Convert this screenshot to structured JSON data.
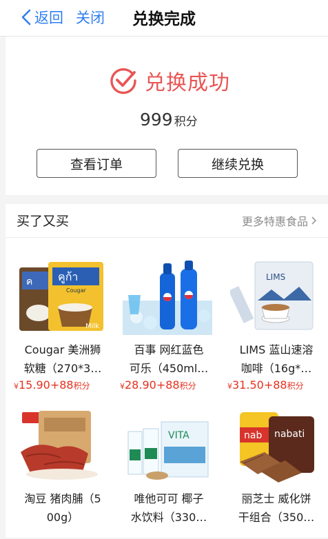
{
  "header": {
    "back_label": "返回",
    "close_label": "关闭",
    "title": "兑换完成"
  },
  "success": {
    "message": "兑换成功",
    "points_value": "999",
    "points_unit": "积分",
    "view_order_label": "查看订单",
    "continue_label": "继续兑换"
  },
  "recommend": {
    "title": "买了又买",
    "more_label": "更多特惠食品",
    "items": [
      {
        "name": "Cougar 美洲狮\n软糖（270*3…",
        "currency": "¥",
        "price": "15.90",
        "plus_points": "+88",
        "points_unit": "积分"
      },
      {
        "name": "百事 网红蓝色\n可乐（450ml…",
        "currency": "¥",
        "price": "28.90",
        "plus_points": "+88",
        "points_unit": "积分"
      },
      {
        "name": "LIMS 蓝山速溶\n咖啡（16g*…",
        "currency": "¥",
        "price": "31.50",
        "plus_points": "+88",
        "points_unit": "积分"
      },
      {
        "name": "淘豆 猪肉脯（5\n00g）",
        "currency": "¥",
        "price": "",
        "plus_points": "",
        "points_unit": ""
      },
      {
        "name": "唯他可可 椰子\n水饮料（330…",
        "currency": "¥",
        "price": "",
        "plus_points": "",
        "points_unit": ""
      },
      {
        "name": "丽芝士 威化饼\n干组合（350…",
        "currency": "¥",
        "price": "",
        "plus_points": "",
        "points_unit": ""
      }
    ]
  },
  "colors": {
    "link_blue": "#2f7ff0",
    "success_red": "#e85555",
    "price_red": "#e5311f"
  }
}
